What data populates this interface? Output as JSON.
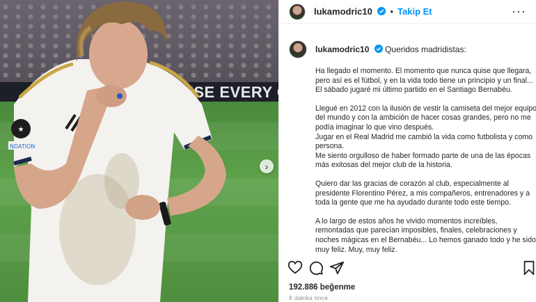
{
  "photo": {
    "banner_text": "USE EVERY CH",
    "carousel_next_glyph": "›"
  },
  "header": {
    "username": "lukamodric10",
    "separator": "•",
    "follow_label": "Takip Et",
    "more_glyph": "···"
  },
  "caption": {
    "username": "lukamodric10",
    "greeting": "Queridos madridistas:",
    "paragraphs": [
      [
        "Ha llegado el momento. El momento que nunca quise que llegara,",
        "pero así es el fútbol, y en la vida todo tiene un principio y un final...",
        "El sábado jugaré mi último partido en el Santiago Bernabéu."
      ],
      [
        "Llegué en 2012 con la ilusión de vestir la camiseta del mejor equipo",
        "del mundo y con la ambición de hacer cosas grandes, pero no me",
        "podía imaginar lo que vino después.",
        "Jugar en el Real Madrid me cambió la vida como futbolista y como",
        "persona.",
        "Me siento orgulloso de haber formado parte de una de las épocas",
        "más exitosas del mejor club de la historia."
      ],
      [
        "Quiero dar las gracias de corazón al club, especialmente al",
        "presidente Florentino Pérez, a mis compañeros, entrenadores y a",
        "toda la gente que me ha ayudado durante todo este tiempo."
      ],
      [
        "A lo largo de estos años he vivido momentos increíbles,",
        "remontadas que parecían imposibles, finales, celebraciones y",
        "noches mágicas en el Bernabéu... Lo hemos ganado todo y he sido",
        "muy feliz. Muy, muy feliz."
      ]
    ]
  },
  "footer": {
    "likes": "192.886 beğenme",
    "time": "8 dakika önce"
  },
  "colors": {
    "accent": "#0095f6",
    "text": "#262626",
    "muted": "#8e8e8e"
  }
}
